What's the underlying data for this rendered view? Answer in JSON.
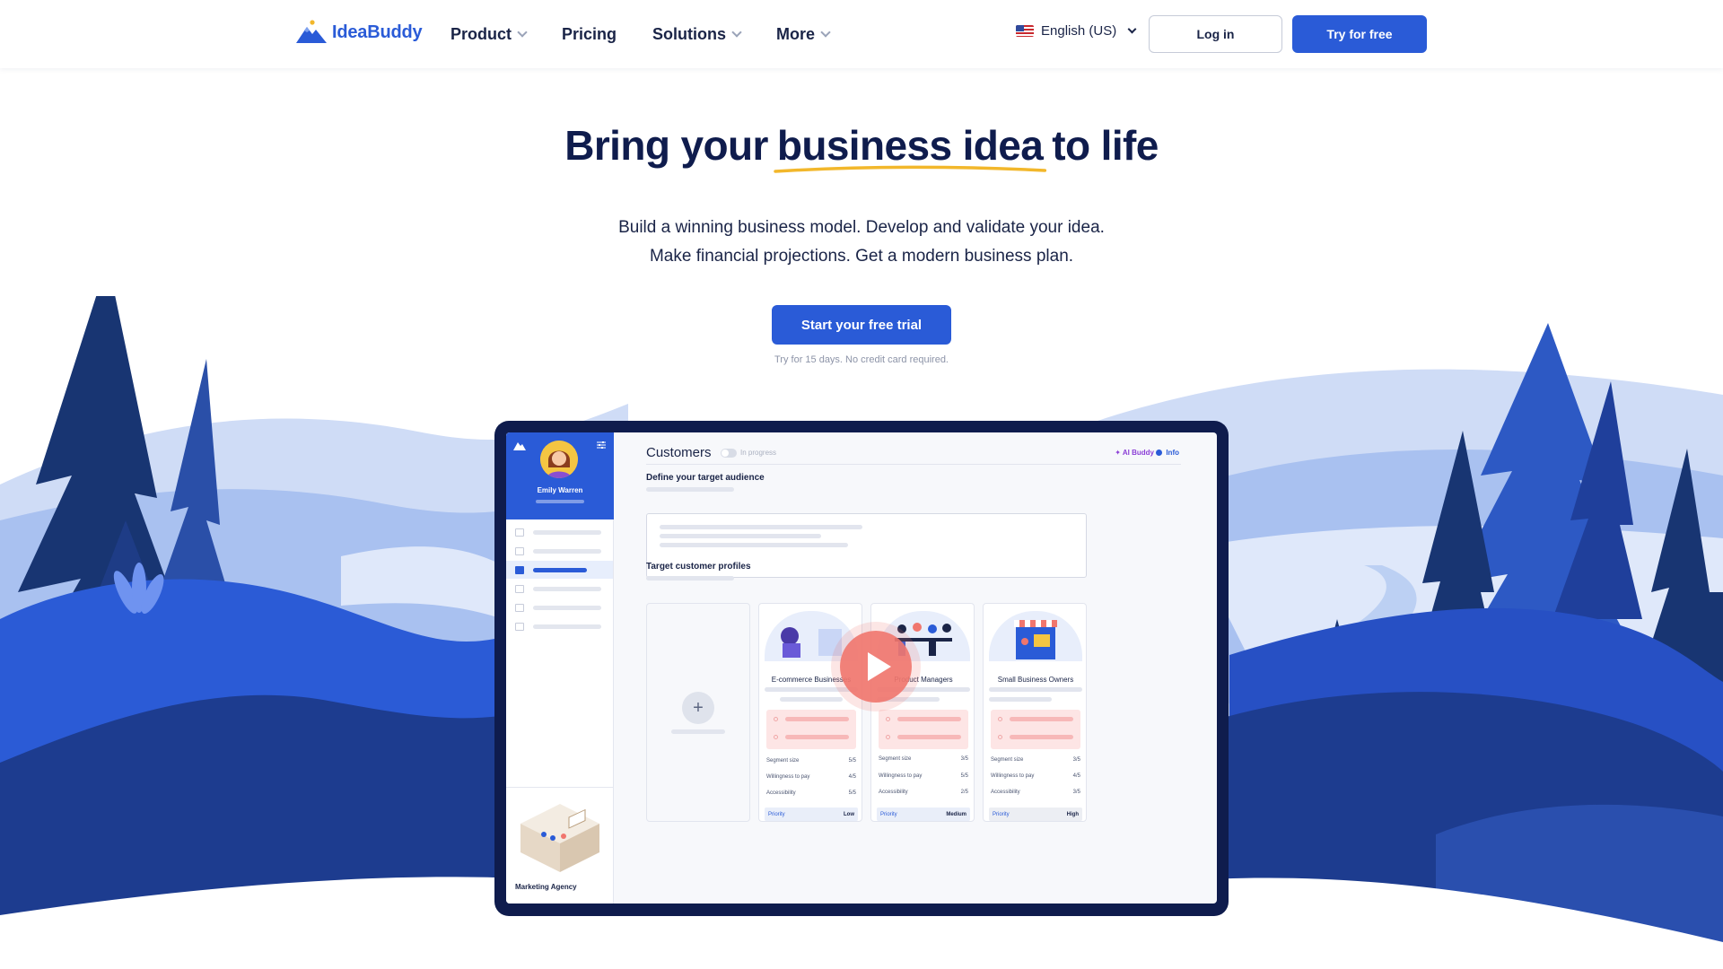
{
  "nav": {
    "logo_text": "IdeaBuddy",
    "links": [
      "Product",
      "Pricing",
      "Solutions",
      "More"
    ],
    "language": "English (US)",
    "login_label": "Log in",
    "try_label": "Try for free"
  },
  "hero": {
    "title_before": "Bring your",
    "title_highlight": "business idea",
    "title_after": "to life",
    "subtitle_line1": "Build a winning business model. Develop and validate your idea.",
    "subtitle_line2": "Make financial projections. Get a modern business plan.",
    "cta_label": "Start your free trial",
    "cta_note": "Try for 15 days. No credit card required."
  },
  "app": {
    "user_name": "Emily Warren",
    "page_title": "Customers",
    "status": "In progress",
    "ai_buddy_label": "AI Buddy",
    "info_label": "Info",
    "section1_title": "Define your target audience",
    "section2_title": "Target customer profiles",
    "bottom_label": "Marketing Agency",
    "stat_labels": [
      "Segment size",
      "Willingness to pay",
      "Accessibility",
      "Priority"
    ],
    "cards": [
      {
        "name": "E-commerce Businesses",
        "segment": "5/5",
        "willingness": "4/5",
        "accessibility": "5/5",
        "priority": "Low"
      },
      {
        "name": "Product Managers",
        "segment": "3/5",
        "willingness": "5/5",
        "accessibility": "2/5",
        "priority": "Medium"
      },
      {
        "name": "Small Business Owners",
        "segment": "3/5",
        "willingness": "4/5",
        "accessibility": "3/5",
        "priority": "High"
      }
    ]
  },
  "colors": {
    "brand_blue": "#2a5bd7",
    "navy": "#0f1c4d",
    "highlight_underline": "#f2b72b",
    "play_button": "#f0766e"
  }
}
